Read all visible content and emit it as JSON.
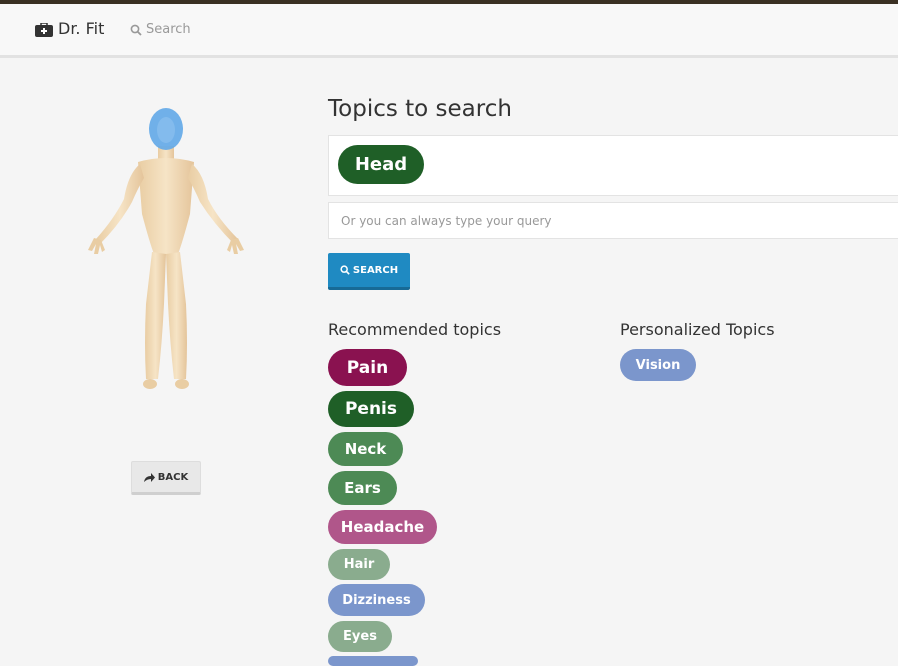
{
  "navbar": {
    "brand": "Dr. Fit",
    "search_label": "Search"
  },
  "body_map": {
    "highlighted_region": "Head",
    "back_label": "BACK"
  },
  "topics": {
    "title": "Topics to search",
    "selected": [
      "Head"
    ],
    "query_placeholder": "Or you can always type your query",
    "search_label": "SEARCH"
  },
  "recommended": {
    "title": "Recommended topics",
    "items": [
      {
        "label": "Pain",
        "color": "#8a1250"
      },
      {
        "label": "Penis",
        "color": "#1f5f27"
      },
      {
        "label": "Neck",
        "color": "#4d8a55"
      },
      {
        "label": "Ears",
        "color": "#4d8a55"
      },
      {
        "label": "Headache",
        "color": "#b0568a"
      },
      {
        "label": "Hair",
        "color": "#8aac8e"
      },
      {
        "label": "Dizziness",
        "color": "#7b96cc"
      },
      {
        "label": "Eyes",
        "color": "#8aac8e"
      }
    ]
  },
  "personalized": {
    "title": "Personalized Topics",
    "items": [
      {
        "label": "Vision",
        "color": "#7b96cc"
      }
    ]
  }
}
